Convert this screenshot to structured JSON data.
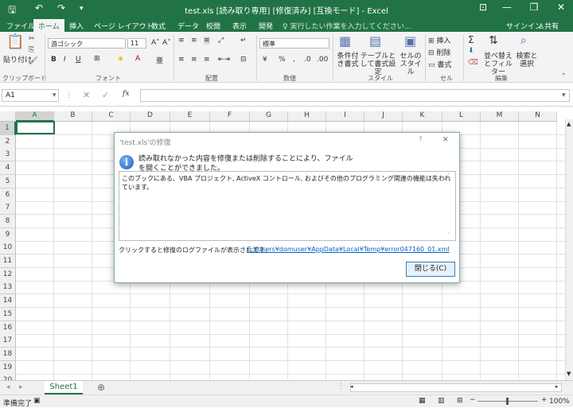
{
  "window": {
    "title": "test.xls [読み取り専用] [修復済み] [互換モード] - Excel",
    "signin": "サインイン",
    "share": "共有"
  },
  "tabs": [
    "ファイル",
    "ホーム",
    "挿入",
    "ページ レイアウト",
    "数式",
    "データ",
    "校閲",
    "表示",
    "開発"
  ],
  "tellme": "実行したい作業を入力してください...",
  "ribbon": {
    "paste": "貼り付け",
    "clipboard": "クリップボード",
    "font_name": "游ゴシック",
    "font_size": "11",
    "font_group": "フォント",
    "bold": "B",
    "italic": "I",
    "underline": "U",
    "align_group": "配置",
    "number_format": "標準",
    "number_group": "数値",
    "cond_format": "条件付き書式",
    "table_format": "テーブルとして書式設定",
    "cell_style": "セルのスタイル",
    "style_group": "スタイル",
    "insert": "挿入",
    "delete": "削除",
    "format": "書式",
    "cells_group": "セル",
    "sort": "並べ替えとフィルター",
    "find": "検索と選択",
    "edit_group": "編集"
  },
  "formula_bar": {
    "name_box": "A1",
    "fx": "fx"
  },
  "columns": [
    "A",
    "B",
    "C",
    "D",
    "E",
    "F",
    "G",
    "H",
    "I",
    "J",
    "K",
    "L",
    "M",
    "N"
  ],
  "rows": [
    "1",
    "2",
    "3",
    "4",
    "5",
    "6",
    "7",
    "8",
    "9",
    "10",
    "11",
    "12",
    "13",
    "14",
    "15",
    "16",
    "17",
    "18",
    "19",
    "20"
  ],
  "dialog": {
    "title": "'test.xls'の修復",
    "help": "?",
    "close_x": "✕",
    "message": "読み取れなかった内容を修復または削除することにより、ファイルを開くことができました。",
    "detail": "このブックにある、VBA プロジェクト, ActiveX コントロール, およびその他のプログラミング関連の機能は失われています。",
    "log_label": "クリックすると修復のログファイルが表示されます:",
    "log_link": "C:¥Users¥domuser¥AppData¥Local¥Temp¥error047160_01.xml",
    "close_button": "閉じる(C)"
  },
  "sheet": {
    "name": "Sheet1"
  },
  "status": {
    "ready": "準備完了",
    "zoom": "100%"
  }
}
